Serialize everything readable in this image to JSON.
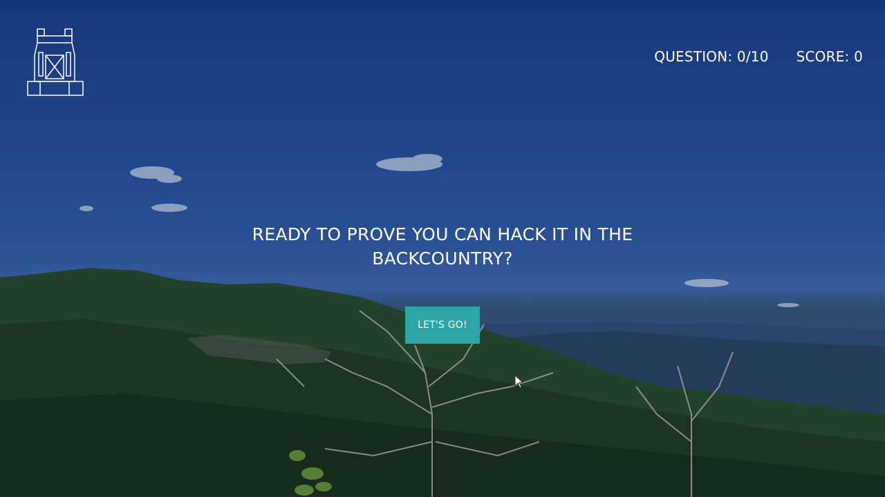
{
  "header": {
    "logo_icon": "backpack-icon",
    "question_label": "QUESTION:",
    "question_value": "0/10",
    "score_label": "SCORE:",
    "score_value": "0"
  },
  "main": {
    "headline": "READY TO PROVE YOU CAN HACK IT IN THE BACKCOUNTRY?",
    "start_button_label": "LET'S GO!"
  },
  "colors": {
    "accent": "#2aa6a6",
    "sky_top": "#1b3f8d",
    "text": "#ffffff"
  }
}
